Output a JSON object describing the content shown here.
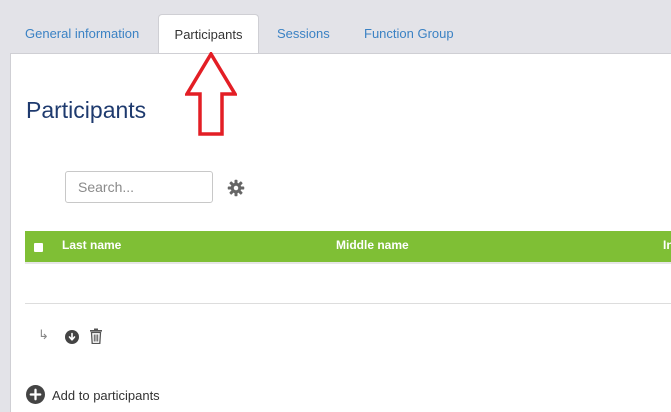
{
  "tabs": {
    "general": "General information",
    "participants": "Participants",
    "sessions": "Sessions",
    "function_group": "Function Group"
  },
  "page_title": "Participants",
  "search": {
    "placeholder": "Search...",
    "value": ""
  },
  "table": {
    "columns": [
      "Last name",
      "Middle name",
      "In"
    ]
  },
  "actions": {
    "add_to_participants": "Add to participants"
  },
  "icons": {
    "settings": "gear-icon",
    "add_row": "add-circle-icon",
    "delete": "trash-icon",
    "add": "plus-circle-icon",
    "annotation": "red-up-arrow-icon"
  },
  "colors": {
    "accent": "#7fbf35",
    "link": "#3b82c4",
    "title": "#1e3a6e",
    "annotation": "#e31e25"
  }
}
